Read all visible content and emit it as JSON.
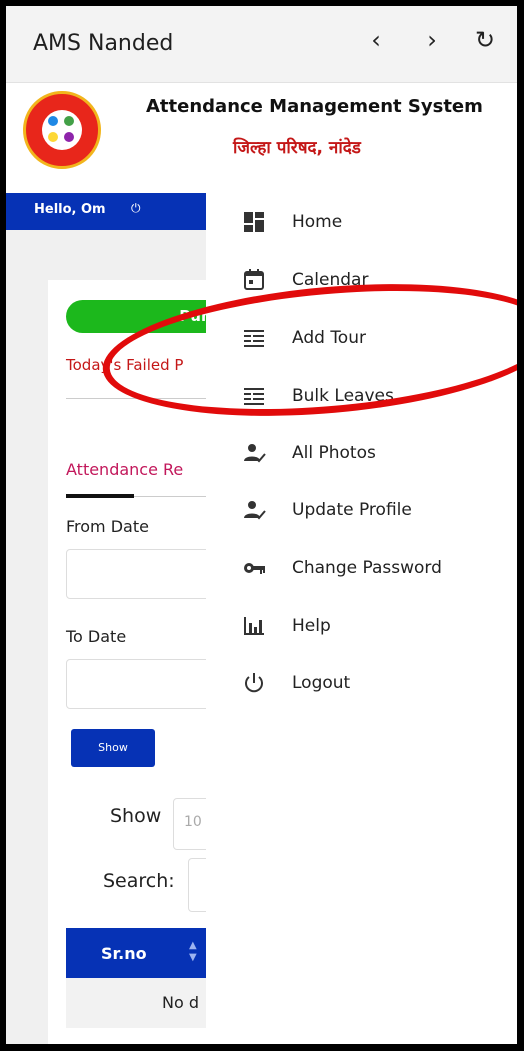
{
  "browser": {
    "title": "AMS Nanded",
    "back_icon": "chevron-left",
    "forward_icon": "chevron-right",
    "reload_icon": "reload"
  },
  "header": {
    "title": "Attendance Management System",
    "subtitle": "जिल्हा परिषद, नांदेड"
  },
  "navbar": {
    "greeting": "Hello, Om",
    "power_icon": "power",
    "menu_icon": "hamburger"
  },
  "page": {
    "punch_label": "Punch In",
    "failed_label": "Today's Failed P",
    "attendance_heading": "Attendance Re",
    "from_date_label": "From Date",
    "to_date_label": "To Date",
    "show_button": "Show",
    "entries_label": "Show",
    "entries_value": "10",
    "search_label": "Search:",
    "table_header": "Sr.no",
    "no_data": "No d"
  },
  "drawer": {
    "items": [
      {
        "label": "Home",
        "icon": "dashboard"
      },
      {
        "label": "Calendar",
        "icon": "calendar"
      },
      {
        "label": "Add Tour",
        "icon": "list"
      },
      {
        "label": "Bulk Leaves",
        "icon": "list"
      },
      {
        "label": "All Photos",
        "icon": "user-check"
      },
      {
        "label": "Update Profile",
        "icon": "user-check"
      },
      {
        "label": "Change Password",
        "icon": "key"
      },
      {
        "label": "Help",
        "icon": "chart"
      },
      {
        "label": "Logout",
        "icon": "power"
      }
    ]
  },
  "colors": {
    "primary": "#0632b5",
    "accent_red": "#c41818",
    "success": "#1cb81c",
    "highlight_ring": "#e10b0b"
  }
}
